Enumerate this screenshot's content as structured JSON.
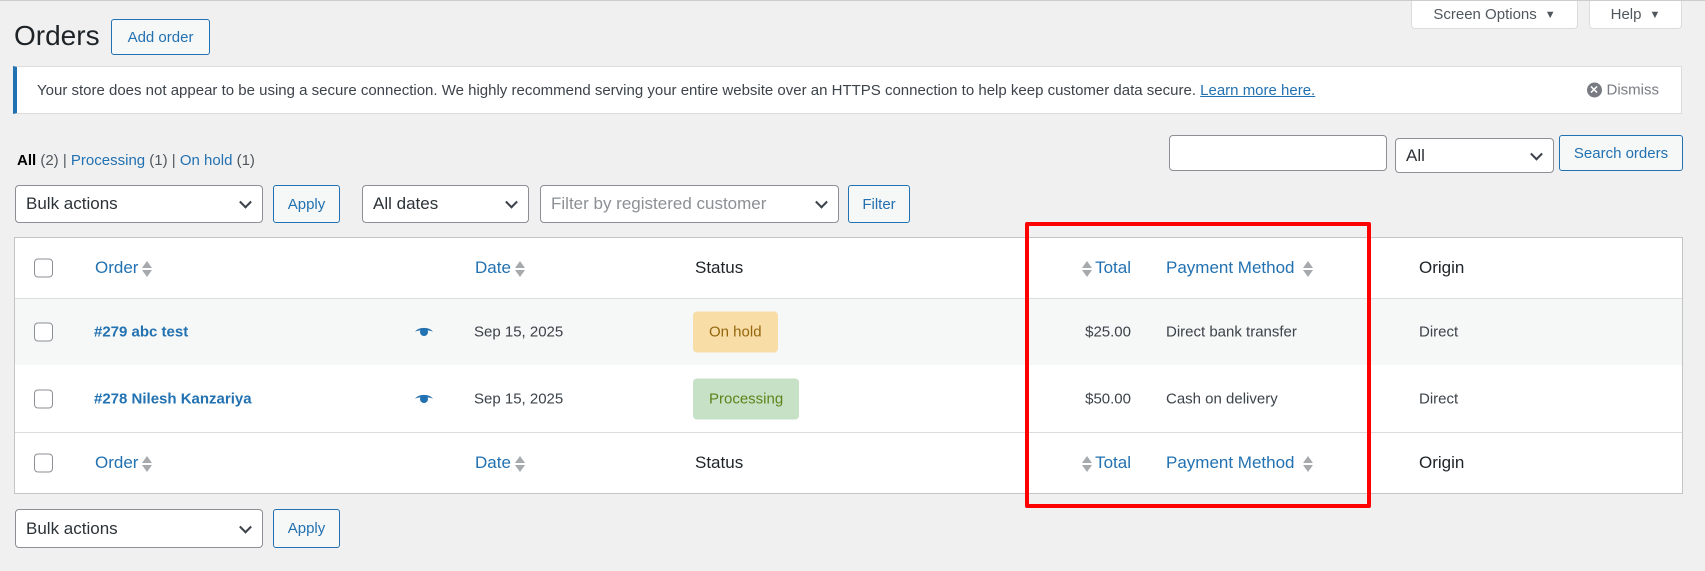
{
  "header": {
    "title": "Orders",
    "add_order": "Add order",
    "screen_options": "Screen Options",
    "help": "Help"
  },
  "notice": {
    "text": "Your store does not appear to be using a secure connection. We highly recommend serving your entire website over an HTTPS connection to help keep customer data secure.",
    "link": "Learn more here.",
    "dismiss": "Dismiss"
  },
  "views": [
    {
      "label": "All",
      "count": "(2)"
    },
    {
      "label": "Processing",
      "count": "(1)"
    },
    {
      "label": "On hold",
      "count": "(1)"
    }
  ],
  "search": {
    "value": "",
    "type_select": "All",
    "button": "Search orders"
  },
  "filters": {
    "bulk_actions": "Bulk actions",
    "apply": "Apply",
    "dates": "All dates",
    "customer_placeholder": "Filter by registered customer",
    "filter": "Filter"
  },
  "columns": {
    "order": "Order",
    "date": "Date",
    "status": "Status",
    "total": "Total",
    "payment": "Payment Method",
    "origin": "Origin"
  },
  "rows": [
    {
      "order": "#279 abc test",
      "date": "Sep 15, 2025",
      "status": "On hold",
      "total": "$25.00",
      "payment": "Direct bank transfer",
      "origin": "Direct"
    },
    {
      "order": "#278 Nilesh Kanzariya",
      "date": "Sep 15, 2025",
      "status": "Processing",
      "total": "$50.00",
      "payment": "Cash on delivery",
      "origin": "Direct"
    }
  ],
  "colors": {
    "accent": "#2271b1",
    "on_hold_bg": "#f8dda7",
    "on_hold_text": "#94660c",
    "processing_bg": "#c6e1c6",
    "processing_text": "#5b841b",
    "highlight": "#ff0000"
  }
}
